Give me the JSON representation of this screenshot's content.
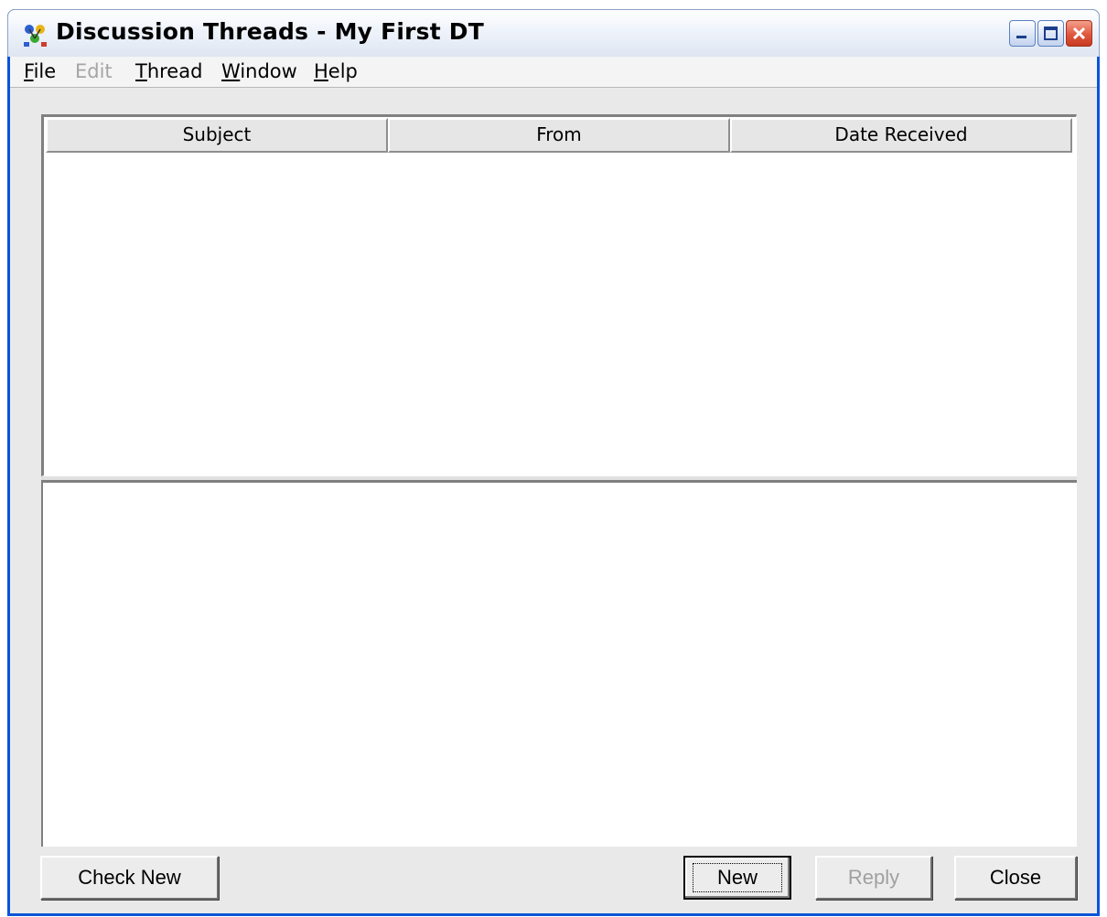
{
  "window": {
    "title": "Discussion Threads - My First DT"
  },
  "menu": {
    "file": {
      "mnemonic": "F",
      "rest": "ile"
    },
    "edit": {
      "label": "Edit",
      "enabled": false
    },
    "thread": {
      "mnemonic": "T",
      "rest": "hread"
    },
    "window": {
      "mnemonic": "W",
      "rest": "indow"
    },
    "help": {
      "mnemonic": "H",
      "rest": "elp"
    }
  },
  "table": {
    "columns": [
      "Subject",
      "From",
      "Date Received"
    ],
    "rows": []
  },
  "message_pane": {
    "content": ""
  },
  "buttons": {
    "check_new": "Check New",
    "new": "New",
    "reply": "Reply",
    "close": "Close"
  },
  "colors": {
    "titlebar": "#eef3fb",
    "window_frame": "#0a54d8",
    "client_bg": "#e9e9ea",
    "disabled_text": "#a5a5a5"
  },
  "icons": {
    "app": "discussion-threads-icon",
    "minimize": "minimize-icon",
    "maximize": "maximize-icon",
    "close": "close-icon"
  }
}
